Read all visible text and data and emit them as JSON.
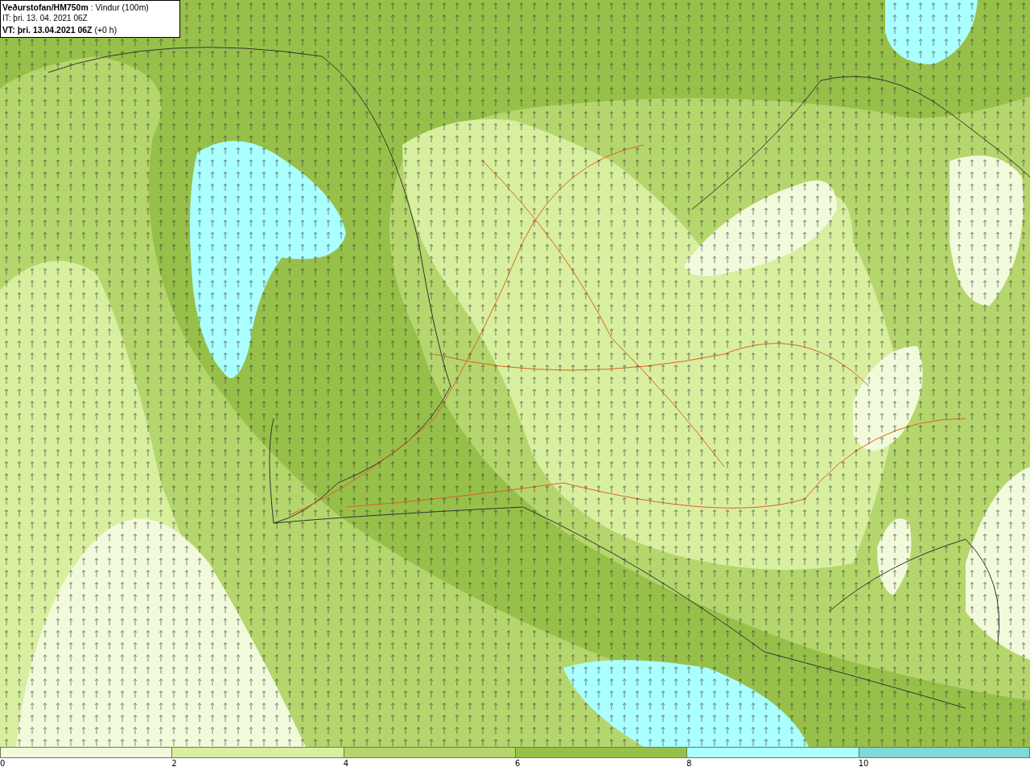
{
  "header": {
    "lines": [
      {
        "kind": "title",
        "text": "**Veðurstofan/HM750m** : Vindur (100m)"
      },
      {
        "kind": "plain",
        "text": "IT: þri. 13. 04. 2021 06Z"
      },
      {
        "kind": "title",
        "text": "**VT: þri. 13.04.2021 06Z** (+0 h)"
      }
    ]
  },
  "legend": {
    "bins": [
      {
        "label": "0",
        "color": "#f2fadc"
      },
      {
        "label": "2",
        "color": "#d8efa0"
      },
      {
        "label": "4",
        "color": "#b5d66c"
      },
      {
        "label": "6",
        "color": "#97c04a"
      },
      {
        "label": "8",
        "color": "#aaffff"
      },
      {
        "label": "10",
        "color": "#80d8d8"
      }
    ]
  }
}
